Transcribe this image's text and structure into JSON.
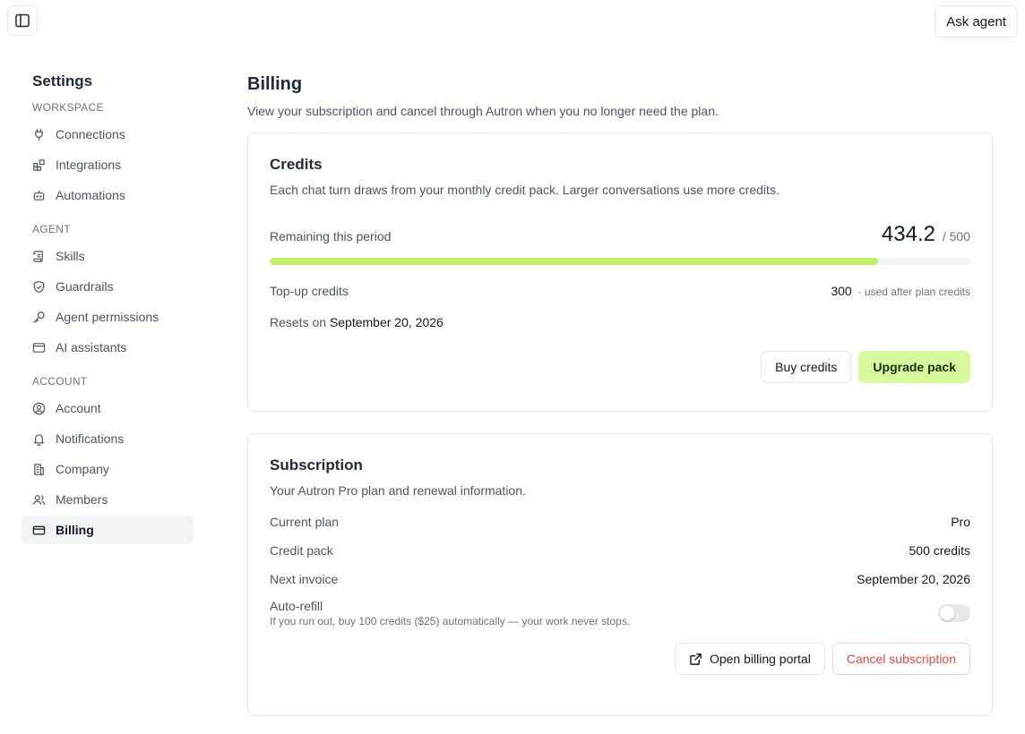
{
  "topbar": {
    "ask_agent_label": "Ask agent"
  },
  "sidebar": {
    "title": "Settings",
    "sections": [
      {
        "label": "WORKSPACE",
        "items": [
          {
            "label": "Connections",
            "icon": "plug-icon"
          },
          {
            "label": "Integrations",
            "icon": "blocks-icon"
          },
          {
            "label": "Automations",
            "icon": "bot-icon"
          }
        ]
      },
      {
        "label": "AGENT",
        "items": [
          {
            "label": "Skills",
            "icon": "scroll-icon"
          },
          {
            "label": "Guardrails",
            "icon": "shield-check-icon"
          },
          {
            "label": "Agent permissions",
            "icon": "key-icon"
          },
          {
            "label": "AI assistants",
            "icon": "browser-window-icon"
          }
        ]
      },
      {
        "label": "ACCOUNT",
        "items": [
          {
            "label": "Account",
            "icon": "user-circle-icon"
          },
          {
            "label": "Notifications",
            "icon": "bell-icon"
          },
          {
            "label": "Company",
            "icon": "building-icon"
          },
          {
            "label": "Members",
            "icon": "users-icon"
          },
          {
            "label": "Billing",
            "icon": "credit-card-icon",
            "active": true
          }
        ]
      }
    ]
  },
  "page": {
    "title": "Billing",
    "subtitle": "View your subscription and cancel through Autron when you no longer need the plan."
  },
  "credits": {
    "title": "Credits",
    "description": "Each chat turn draws from your monthly credit pack. Larger conversations use more credits.",
    "remaining_label": "Remaining this period",
    "remaining_value": "434.2",
    "total_value": "/ 500",
    "progress_fraction": 0.8684,
    "topup_label": "Top-up credits",
    "topup_value": "300",
    "topup_note": "· used after plan credits",
    "resets_prefix": "Resets on",
    "resets_date": "September 20, 2026",
    "buy_label": "Buy credits",
    "upgrade_label": "Upgrade pack"
  },
  "subscription": {
    "title": "Subscription",
    "description": "Your Autron Pro plan and renewal information.",
    "rows": [
      {
        "label": "Current plan",
        "value": "Pro"
      },
      {
        "label": "Credit pack",
        "value": "500 credits"
      },
      {
        "label": "Next invoice",
        "value": "September 20, 2026"
      }
    ],
    "auto_refill_label": "Auto-refill",
    "auto_refill_hint": "If you run out, buy 100 credits ($25) automatically — your work never stops.",
    "auto_refill_on": false,
    "portal_label": "Open billing portal",
    "cancel_label": "Cancel subscription"
  },
  "colors": {
    "accent": "#d9f99d",
    "progress": "#bef264",
    "danger": "#ef4444"
  }
}
